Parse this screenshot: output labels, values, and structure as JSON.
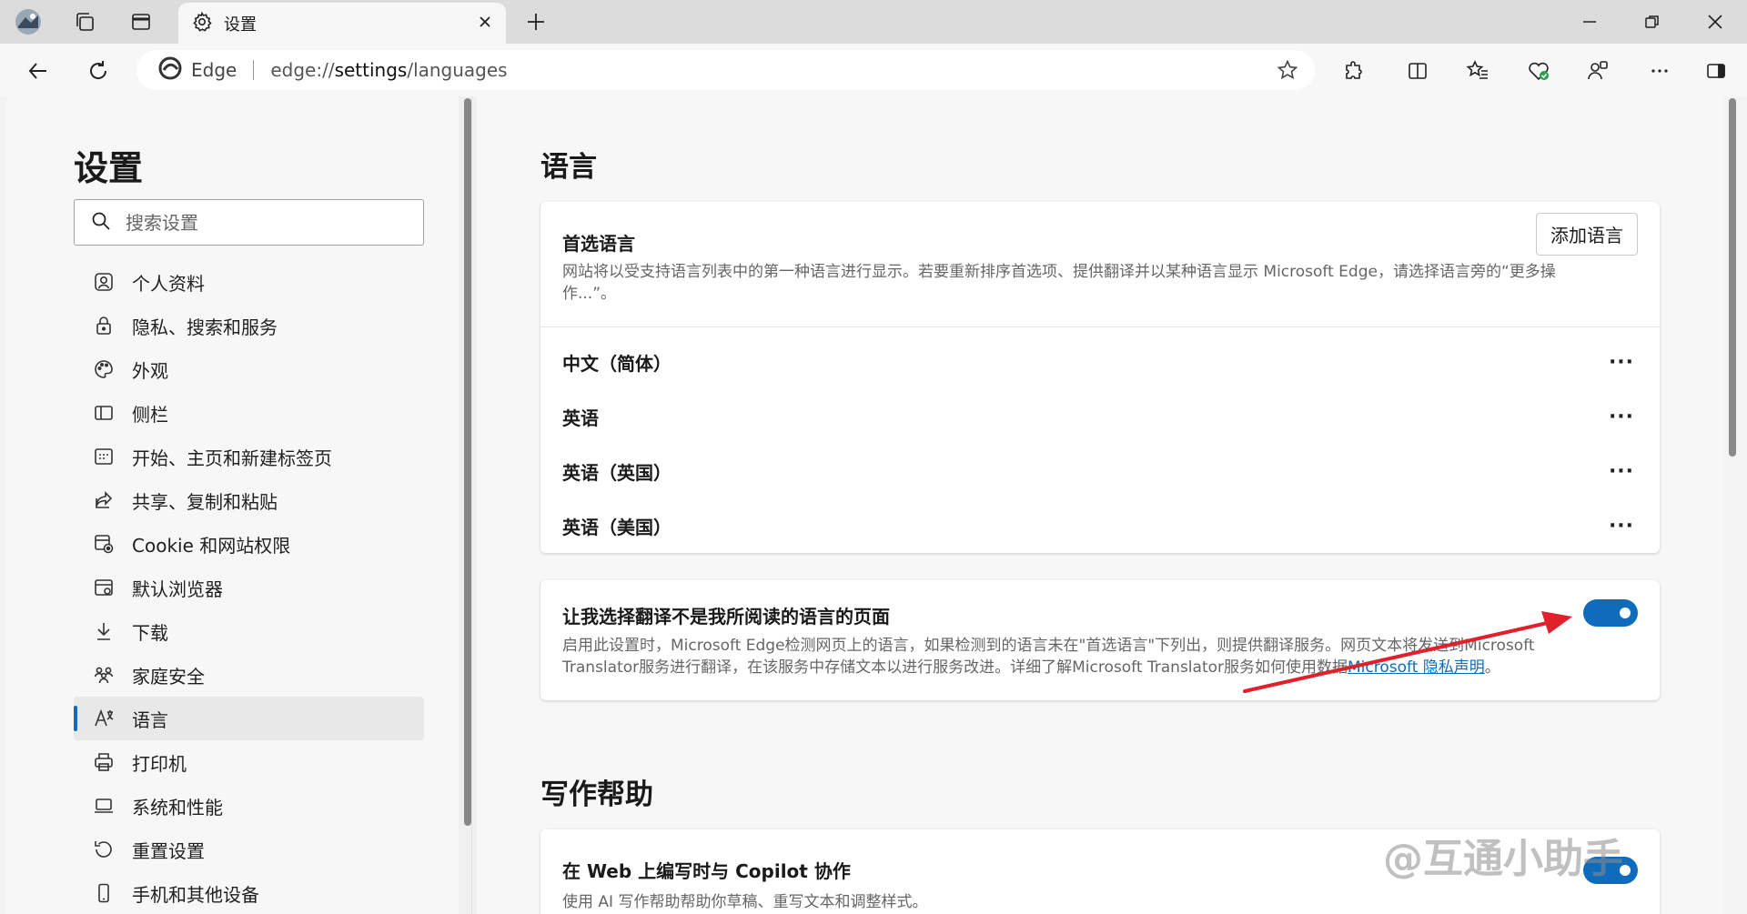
{
  "tab": {
    "title": "设置"
  },
  "address": {
    "edge_label": "Edge",
    "url_prefix": "edge://",
    "url_host": "settings",
    "url_path": "/languages"
  },
  "sidebar": {
    "title": "设置",
    "search_placeholder": "搜索设置",
    "items": [
      {
        "label": "个人资料",
        "icon": "profile-icon"
      },
      {
        "label": "隐私、搜索和服务",
        "icon": "lock-icon"
      },
      {
        "label": "外观",
        "icon": "palette-icon"
      },
      {
        "label": "侧栏",
        "icon": "sidebar-icon"
      },
      {
        "label": "开始、主页和新建标签页",
        "icon": "home-grid-icon"
      },
      {
        "label": "共享、复制和粘贴",
        "icon": "share-icon"
      },
      {
        "label": "Cookie 和网站权限",
        "icon": "cookie-icon"
      },
      {
        "label": "默认浏览器",
        "icon": "browser-icon"
      },
      {
        "label": "下载",
        "icon": "download-icon"
      },
      {
        "label": "家庭安全",
        "icon": "family-icon"
      },
      {
        "label": "语言",
        "icon": "language-icon",
        "active": true
      },
      {
        "label": "打印机",
        "icon": "printer-icon"
      },
      {
        "label": "系统和性能",
        "icon": "laptop-icon"
      },
      {
        "label": "重置设置",
        "icon": "reset-icon"
      },
      {
        "label": "手机和其他设备",
        "icon": "phone-icon"
      }
    ]
  },
  "languages": {
    "section_title": "语言",
    "preferred_title": "首选语言",
    "preferred_desc": "网站将以受支持语言列表中的第一种语言进行显示。若要重新排序首选项、提供翻译并以某种语言显示 Microsoft Edge，请选择语言旁的“更多操作...”。",
    "add_button": "添加语言",
    "list": [
      "中文（简体）",
      "英语",
      "英语（英国）",
      "英语（美国）"
    ],
    "more_label": "···"
  },
  "translate": {
    "title": "让我选择翻译不是我所阅读的语言的页面",
    "desc": "启用此设置时，Microsoft Edge检测网页上的语言，如果检测到的语言未在\"首选语言\"下列出，则提供翻译服务。网页文本将发送到Microsoft Translator服务进行翻译，在该服务中存储文本以进行服务改进。详细了解Microsoft Translator服务如何使用数据",
    "link": "Microsoft 隐私声明",
    "link_tail": "。",
    "enabled": true
  },
  "writing": {
    "section_title": "写作帮助",
    "card_title": "在 Web 上编写时与 Copilot 协作",
    "card_desc": "使用 AI 写作帮助帮助你草稿、重写文本和调整样式。"
  },
  "watermark": "@互通小助手",
  "colors": {
    "accent": "#0f6cbd",
    "annotation": "#e0202a"
  }
}
